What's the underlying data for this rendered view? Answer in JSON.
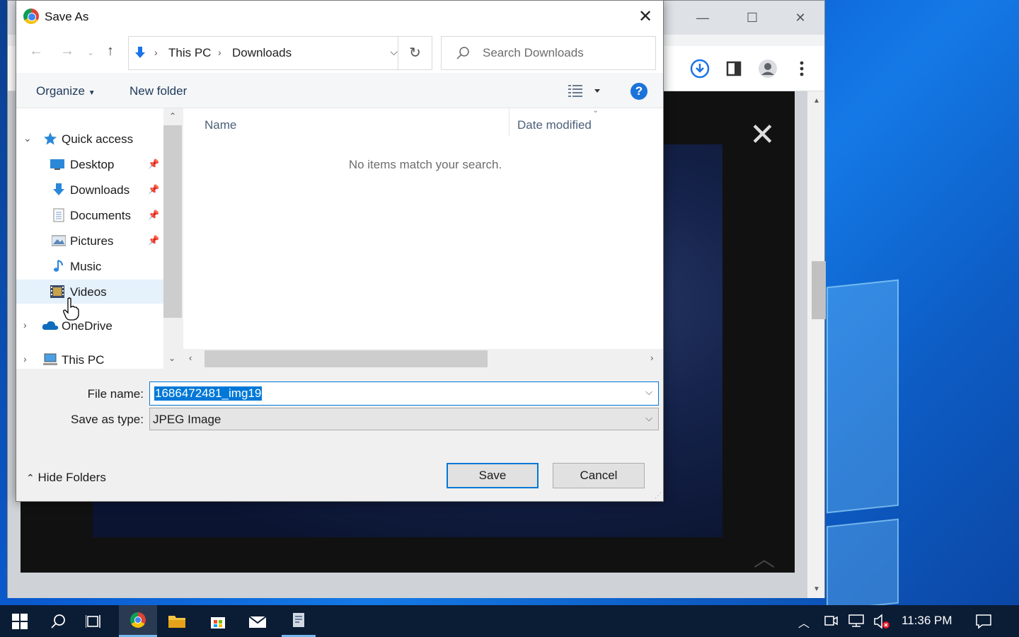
{
  "browser": {
    "minimize": "—",
    "maximize": "☐",
    "close": "✕"
  },
  "dialog": {
    "title": "Save As",
    "nav": {
      "back_icon": "arrow-left-icon",
      "forward_icon": "arrow-right-icon",
      "up_icon": "arrow-up-icon"
    },
    "address": {
      "crumbs": [
        "This PC",
        "Downloads"
      ]
    },
    "search": {
      "placeholder": "Search Downloads"
    },
    "commands": {
      "organize": "Organize",
      "new_folder": "New folder"
    },
    "tree": {
      "quick_access": "Quick access",
      "items": [
        {
          "label": "Desktop",
          "icon": "desktop-icon",
          "pinned": true
        },
        {
          "label": "Downloads",
          "icon": "download-icon",
          "pinned": true
        },
        {
          "label": "Documents",
          "icon": "documents-icon",
          "pinned": true
        },
        {
          "label": "Pictures",
          "icon": "pictures-icon",
          "pinned": true
        },
        {
          "label": "Music",
          "icon": "music-icon",
          "pinned": false
        },
        {
          "label": "Videos",
          "icon": "videos-icon",
          "pinned": false
        }
      ],
      "onedrive": "OneDrive",
      "this_pc": "This PC"
    },
    "files": {
      "col_name": "Name",
      "col_date": "Date modified",
      "empty_message": "No items match your search."
    },
    "form": {
      "file_name_label": "File name:",
      "file_name_value": "1686472481_img19",
      "save_type_label": "Save as type:",
      "save_type_value": "JPEG Image"
    },
    "hide_folders": "Hide Folders",
    "save_label": "Save",
    "cancel_label": "Cancel"
  },
  "taskbar": {
    "clock": "11:36 PM"
  },
  "colors": {
    "accent": "#0078d7",
    "taskbar": "#0b1c35",
    "desktop": "#0a5bd0"
  }
}
